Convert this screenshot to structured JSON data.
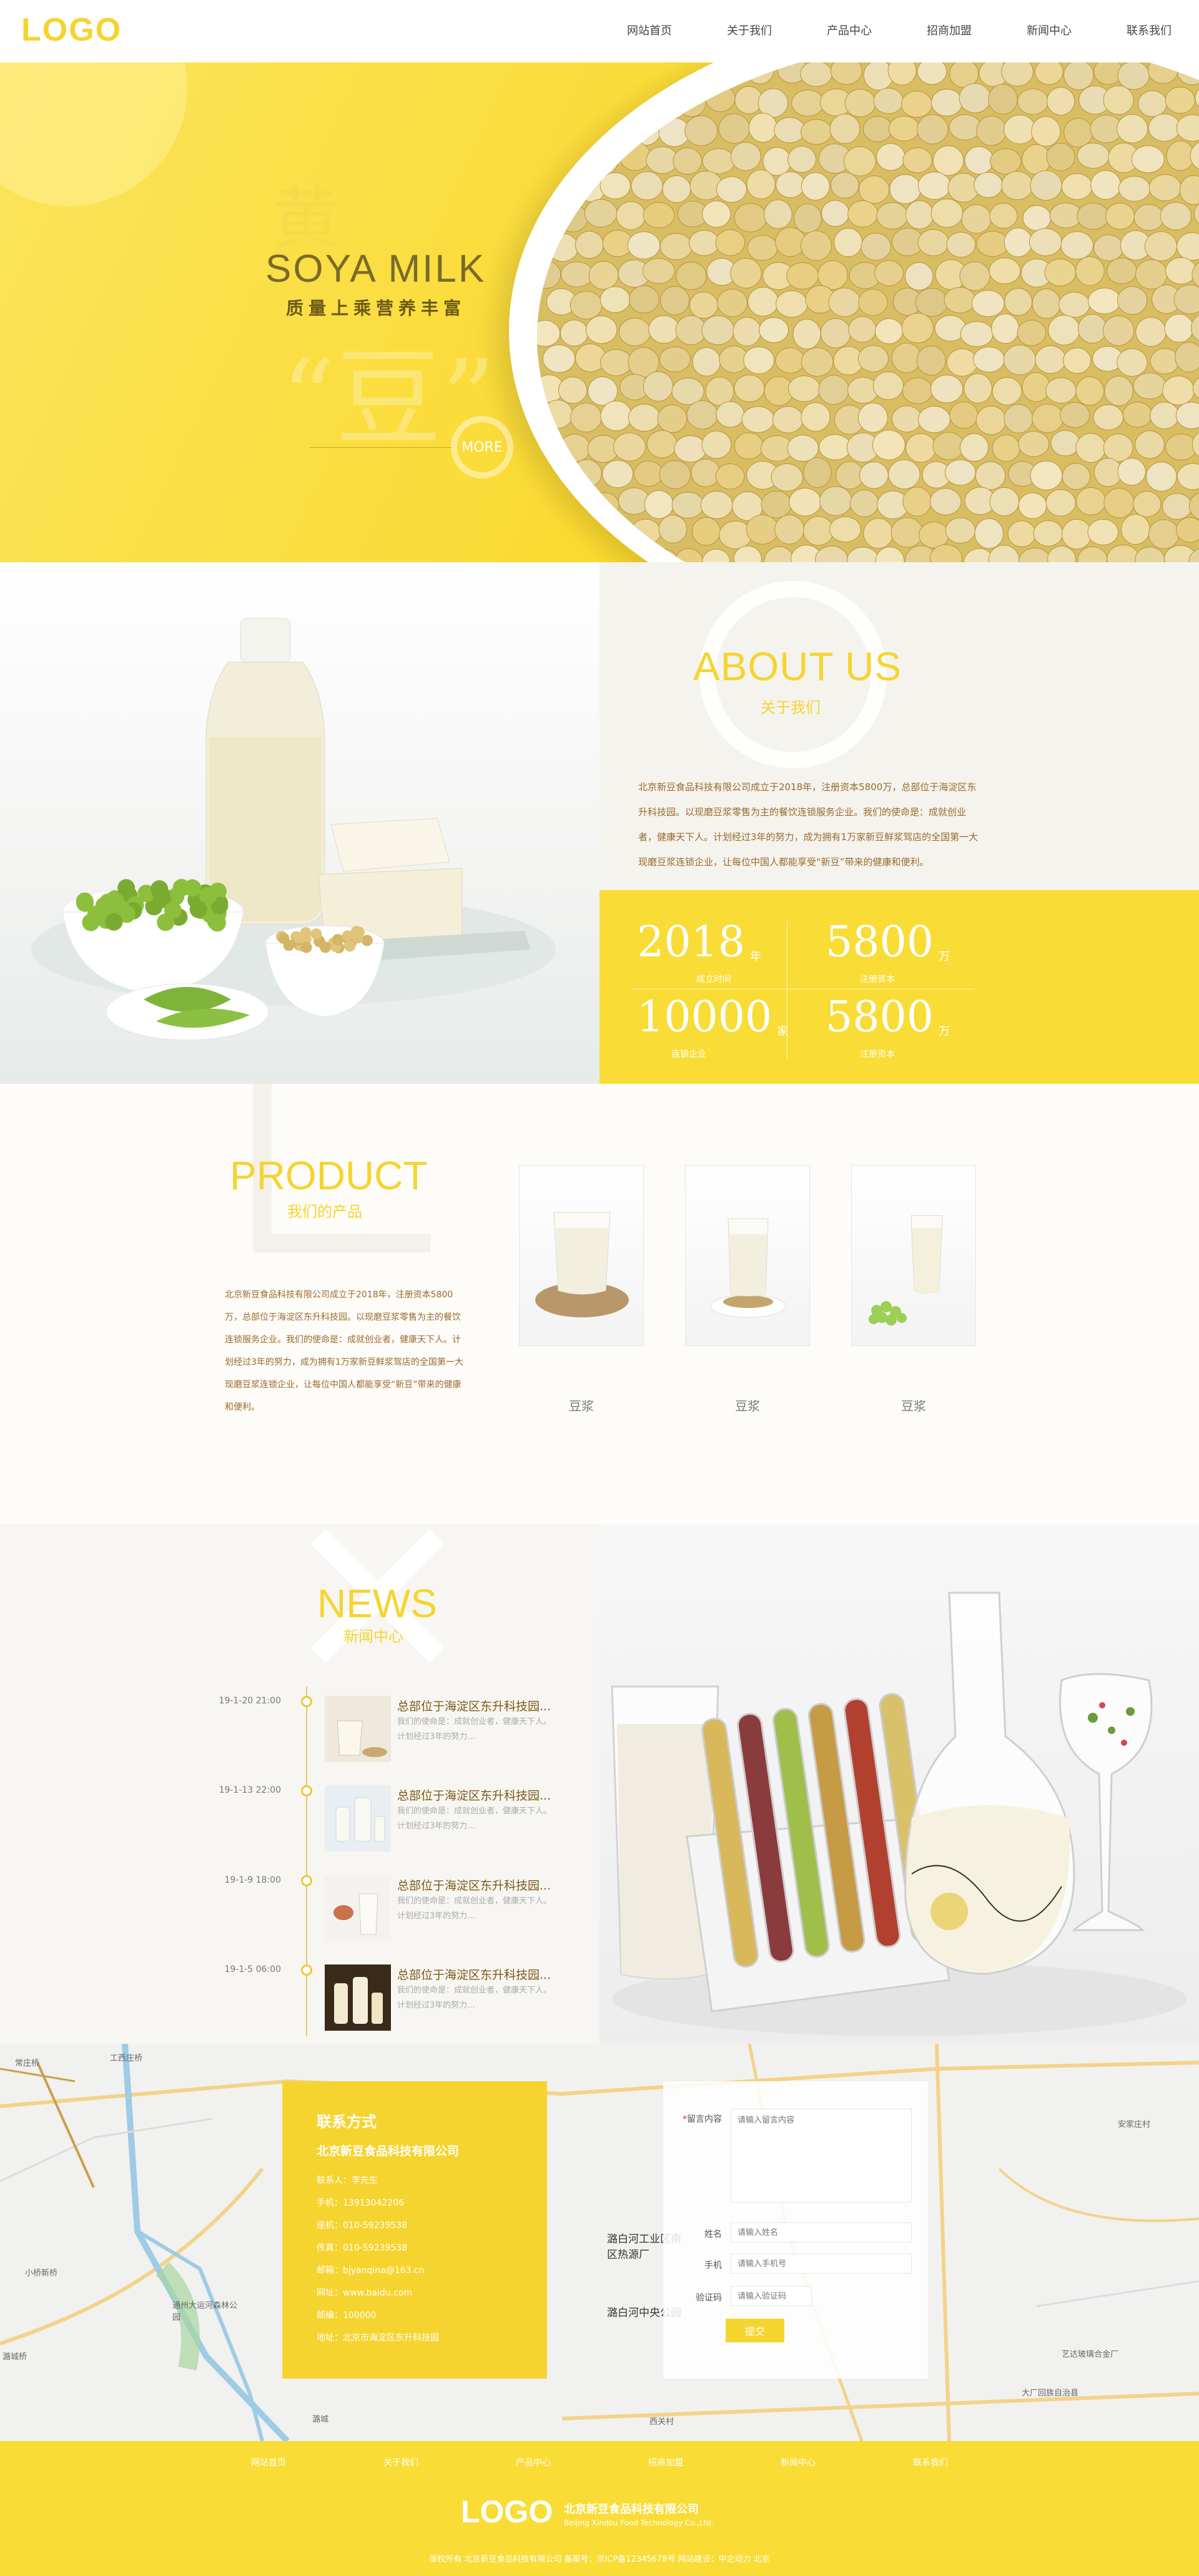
{
  "header": {
    "logo": "LOGO",
    "nav": [
      "网站首页",
      "关于我们",
      "产品中心",
      "招商加盟",
      "新闻中心",
      "联系我们"
    ]
  },
  "hero": {
    "big_char_1": "黄",
    "title": "SOYA MILK",
    "subtitle": "质量上乘营养丰富",
    "big_char_2": "“豆”",
    "more": "MORE"
  },
  "about": {
    "title": "ABOUT US",
    "subtitle": "关于我们",
    "text": "北京新豆食品科技有限公司成立于2018年，注册资本5800万，总部位于海淀区东升科技园。以现磨豆浆零售为主的餐饮连锁服务企业。我们的使命是：成就创业者，健康天下人。计划经过3年的努力，成为拥有1万家新豆鲜浆驾店的全国第一大现磨豆浆连锁企业，让每位中国人都能享受“新豆”带来的健康和便利。",
    "stats": [
      {
        "num": "2018",
        "unit": "年",
        "label": "成立时间"
      },
      {
        "num": "5800",
        "unit": "万",
        "label": "注册资本"
      },
      {
        "num": "10000",
        "unit": "家",
        "label": "连锁企业"
      },
      {
        "num": "5800",
        "unit": "万",
        "label": "注册资本"
      }
    ]
  },
  "product": {
    "title": "PRODUCT",
    "subtitle": "我们的产品",
    "text": "北京新豆食品科技有限公司成立于2018年，注册资本5800万，总部位于海淀区东升科技园。以现磨豆浆零售为主的餐饮连锁服务企业。我们的使命是：成就创业者，健康天下人。计划经过3年的努力，成为拥有1万家新豆鲜浆驾店的全国第一大现磨豆浆连锁企业，让每位中国人都能享受“新豆”带来的健康和便利。",
    "items": [
      {
        "label": "豆浆"
      },
      {
        "label": "豆浆"
      },
      {
        "label": "豆浆"
      }
    ]
  },
  "news": {
    "title": "NEWS",
    "subtitle": "新闻中心",
    "items": [
      {
        "date": "19-1-20 21:00",
        "headline": "总部位于海淀区东升科技园...",
        "desc": "我们的使命是：成就创业者，健康天下人。计划经过3年的努力..."
      },
      {
        "date": "19-1-13 22:00",
        "headline": "总部位于海淀区东升科技园...",
        "desc": "我们的使命是：成就创业者，健康天下人。计划经过3年的努力..."
      },
      {
        "date": "19-1-9 18:00",
        "headline": "总部位于海淀区东升科技园...",
        "desc": "我们的使命是：成就创业者，健康天下人。计划经过3年的努力..."
      },
      {
        "date": "19-1-5 06:00",
        "headline": "总部位于海淀区东升科技园...",
        "desc": "我们的使命是：成就创业者，健康天下人。计划经过3年的努力..."
      }
    ]
  },
  "contact": {
    "title": "联系方式",
    "company": "北京新豆食品科技有限公司",
    "rows": [
      "联系人：李先生",
      "手机：13913042206",
      "座机：010-59239538",
      "传真：010-59239538",
      "邮箱：bjyanqina@163.cn",
      "网址：www.baidu.com",
      "邮编：100000",
      "地址：北京市海淀区东升科技园"
    ]
  },
  "form": {
    "message_label": "留言内容",
    "message_placeholder": "请输入留言内容",
    "name_label": "姓名",
    "name_placeholder": "请输入姓名",
    "phone_label": "手机",
    "phone_placeholder": "请输入手机号",
    "code_label": "验证码",
    "code_placeholder": "请输入验证码",
    "submit": "提交"
  },
  "map_labels": [
    "常庄桥",
    "工西庄桥",
    "通州大运河森林公园",
    "潞城",
    "潞城桥",
    "西关村",
    "潞白河工业区南区热源厂",
    "潞白河中央公园",
    "艺达玻璃合金厂",
    "大厂回族自治县",
    "安家庄村",
    "小桥新桥"
  ],
  "footer": {
    "nav": [
      "网站首页",
      "关于我们",
      "产品中心",
      "招商加盟",
      "新闻中心",
      "联系我们"
    ],
    "logo": "LOGO",
    "company": "北京新豆食品科技有限公司",
    "company_en": "Beijing Xindou Food Technology Co.,Ltd.",
    "copyright": "版权所有 北京新豆食品科技有限公司 备案号：京ICP备12345678号 网站建设：中企动力 北京"
  },
  "colors": {
    "accent": "#f6d430",
    "footer": "#f9dc36",
    "text_brown": "#9a6a2a"
  }
}
